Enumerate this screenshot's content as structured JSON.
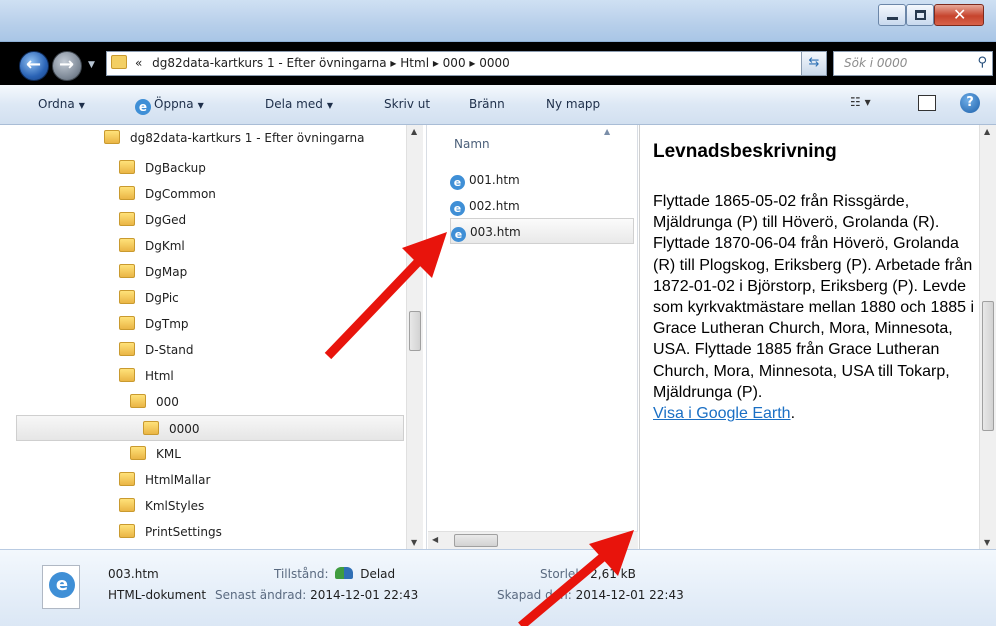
{
  "address": {
    "prefix": "«",
    "crumbs": "dg82data-kartkurs 1 - Efter övningarna  ▸  Html  ▸  000  ▸  0000",
    "search_placeholder": "Sök i 0000"
  },
  "toolbar": {
    "organize": "Ordna",
    "open": "Öppna",
    "share": "Dela med",
    "print": "Skriv ut",
    "burn": "Bränn",
    "new_folder": "Ny mapp"
  },
  "nav": {
    "items": [
      {
        "label": "dg82data-kartkurs 1 - Efter övningarna"
      },
      {
        "label": "DgBackup"
      },
      {
        "label": "DgCommon"
      },
      {
        "label": "DgGed"
      },
      {
        "label": "DgKml"
      },
      {
        "label": "DgMap"
      },
      {
        "label": "DgPic"
      },
      {
        "label": "DgTmp"
      },
      {
        "label": "D-Stand"
      },
      {
        "label": "Html"
      },
      {
        "label": "000"
      },
      {
        "label": "0000"
      },
      {
        "label": "KML"
      },
      {
        "label": "HtmlMallar"
      },
      {
        "label": "KmlStyles"
      },
      {
        "label": "PrintSettings"
      }
    ]
  },
  "files": {
    "column": "Namn",
    "items": [
      {
        "name": "001.htm"
      },
      {
        "name": "002.htm"
      },
      {
        "name": "003.htm"
      }
    ]
  },
  "preview": {
    "title": "Levnadsbeskrivning",
    "body": "Flyttade 1865-05-02 från Rissgärde, Mjäldrunga (P) till Höverö, Grolanda (R). Flyttade 1870-06-04 från Höverö, Grolanda (R) till Plogskog, Eriksberg (P). Arbetade från 1872-01-02 i Björstorp, Eriksberg (P). Levde som kyrkvaktmästare mellan 1880 och 1885 i Grace Lutheran Church, Mora, Minnesota, USA. Flyttade 1885 från Grace Lutheran Church, Mora, Minnesota, USA till Tokarp, Mjäldrunga (P).",
    "link": "Visa i Google Earth",
    "link_suffix": "."
  },
  "details": {
    "filename": "003.htm",
    "filetype": "HTML-dokument",
    "state_label": "Tillstånd:",
    "state_value": "Delad",
    "size_label": "Storlek:",
    "size_value": "2,61 kB",
    "modified_label": "Senast ändrad:",
    "modified_value": "2014-12-01 22:43",
    "created_label": "Skapad den:",
    "created_value": "2014-12-01 22:43"
  },
  "colors": {
    "annotation_arrow": "#e8140c",
    "link": "#1a6fc4",
    "titlebar": "#b7cfea"
  }
}
